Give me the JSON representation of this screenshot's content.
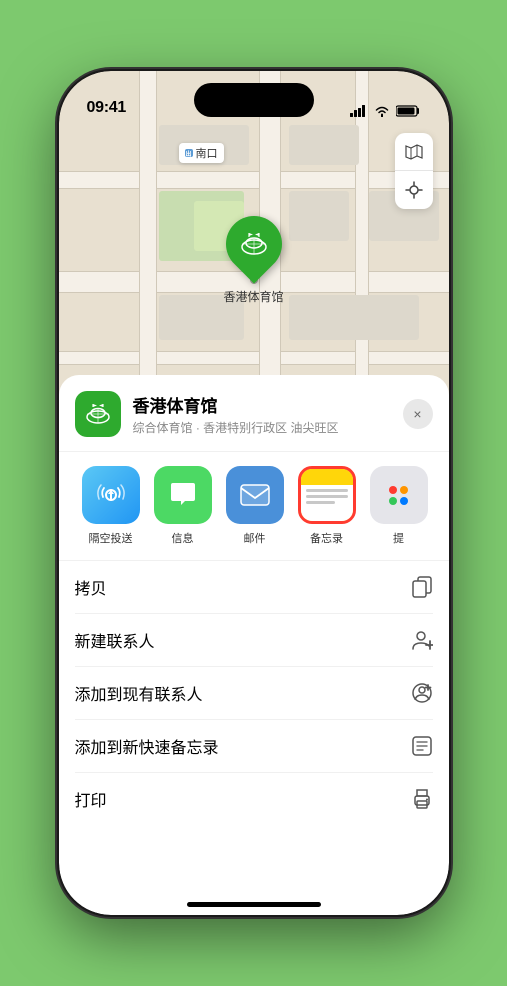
{
  "status_bar": {
    "time": "09:41",
    "signal_bars": "▌▌▌",
    "wifi": "wifi",
    "battery": "battery"
  },
  "map": {
    "label_text": "南口",
    "label_prefix": "出",
    "venue_name": "香港体育馆",
    "venue_emoji": "🏟️"
  },
  "sheet": {
    "venue_name": "香港体育馆",
    "venue_subtitle": "综合体育馆 · 香港特别行政区 油尖旺区",
    "close_label": "×"
  },
  "share_actions": [
    {
      "id": "airdrop",
      "label": "隔空投送",
      "type": "airdrop"
    },
    {
      "id": "messages",
      "label": "信息",
      "type": "messages"
    },
    {
      "id": "mail",
      "label": "邮件",
      "type": "mail"
    },
    {
      "id": "notes",
      "label": "备忘录",
      "type": "notes"
    },
    {
      "id": "more",
      "label": "提",
      "type": "more"
    }
  ],
  "action_items": [
    {
      "id": "copy",
      "label": "拷贝",
      "icon": "copy"
    },
    {
      "id": "new-contact",
      "label": "新建联系人",
      "icon": "person-add"
    },
    {
      "id": "add-existing",
      "label": "添加到现有联系人",
      "icon": "person-circle"
    },
    {
      "id": "add-note",
      "label": "添加到新快速备忘录",
      "icon": "note"
    },
    {
      "id": "print",
      "label": "打印",
      "icon": "printer"
    }
  ],
  "colors": {
    "green": "#2eaa2e",
    "notes_yellow": "#ffd60a",
    "notes_border": "#ff3b30",
    "airdrop_blue": "#4a90d9",
    "messages_green": "#4cd964",
    "mail_blue": "#4a90d9"
  }
}
